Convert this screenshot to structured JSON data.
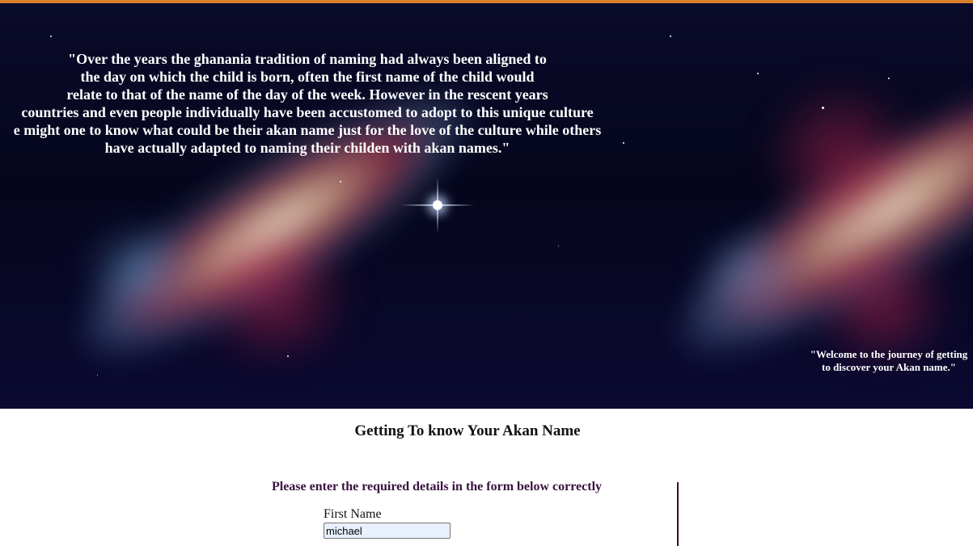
{
  "colors": {
    "top_bar": "#d9822b",
    "hero_background": "#05061d",
    "instruction_text": "#3a1240",
    "divider": "#3a0c2a",
    "input_autofill_bg": "#e8f0fe"
  },
  "hero": {
    "quote": "\"Over the years the ghanania tradition of naming had always been aligned to\nthe day on which the child is born, often the first name of the child would\nrelate to that of the name of the day of the week. However in the rescent years\ncountries and even people individually have been accustomed to adopt to this unique culture\ne might one to know what could be their akan name just for the love of the culture while others\nhave actually adapted to naming their childen with akan names.\"",
    "welcome": "\"Welcome to the journey of getting\nto discover your Akan name.\""
  },
  "main": {
    "heading": "Getting To know Your Akan Name",
    "instruction": "Please enter the required details in the form below correctly",
    "form": {
      "first_name_label": "First Name",
      "first_name_value": "michael"
    }
  }
}
